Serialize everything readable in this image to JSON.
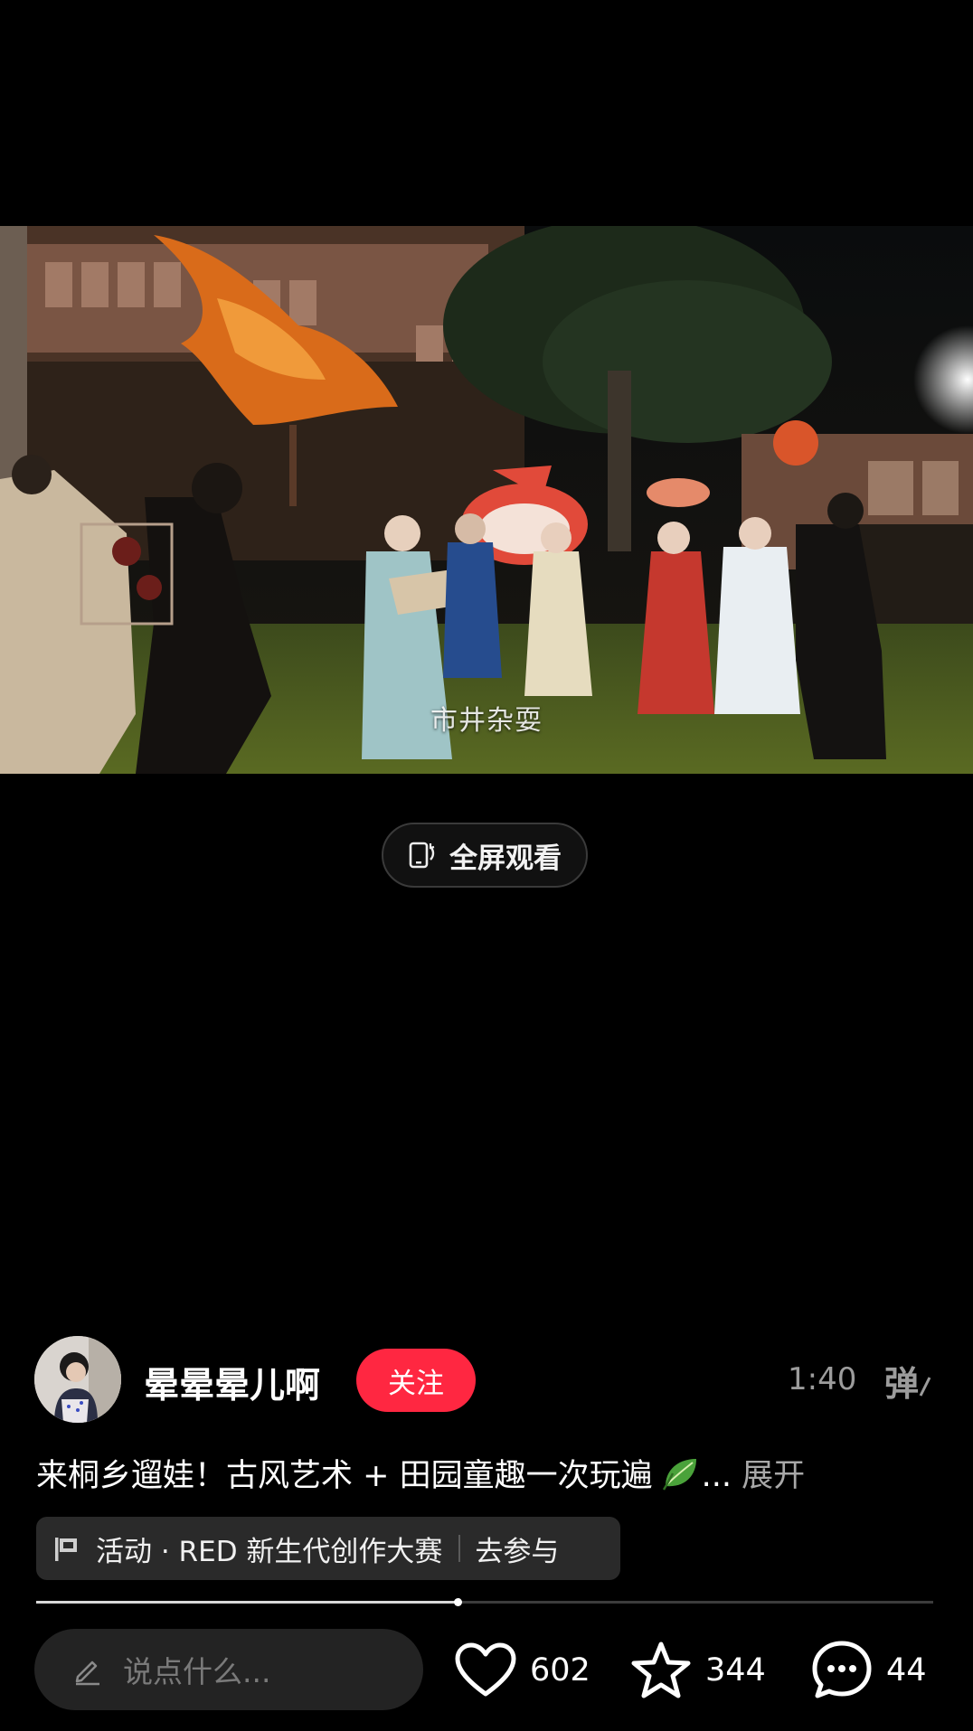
{
  "video": {
    "caption": "市井杂耍"
  },
  "fullscreen": {
    "label": "全屏观看",
    "icon": "fullscreen-rotate-icon"
  },
  "author": {
    "name": "晕晕晕儿啊",
    "follow_label": "关注",
    "avatar_icon": "user-avatar"
  },
  "player": {
    "duration": "1:40",
    "danmaku_label": "弹",
    "progress": 0.47
  },
  "post": {
    "description": "来桐乡遛娃！古风艺术 + 田园童趣一次玩遍",
    "ellipsis": "...",
    "expand_label": "展开",
    "emoji_icon": "leaf-emoji-icon"
  },
  "activity": {
    "label": "活动 · RED 新生代创作大赛",
    "join_label": "去参与",
    "icon": "flag-icon"
  },
  "bottom_bar": {
    "comment_placeholder": "说点什么...",
    "likes": "602",
    "favorites": "344",
    "comments": "44"
  },
  "colors": {
    "accent": "#ff2741",
    "background": "#000000",
    "muted_text": "#9c9c9c"
  }
}
